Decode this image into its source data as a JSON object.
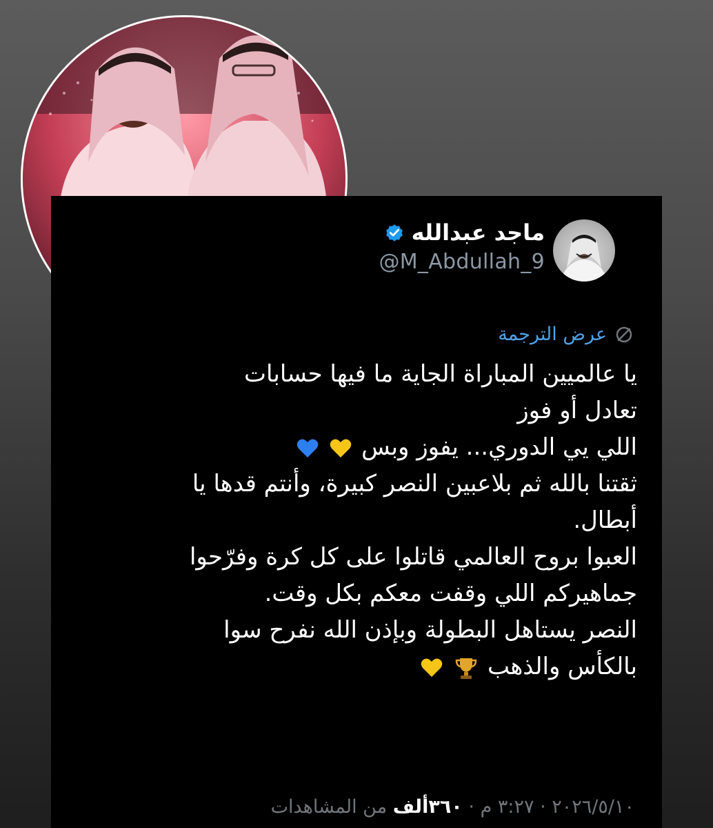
{
  "tweet": {
    "display_name": "ماجد عبدالله",
    "handle": "@M_Abdullah_9",
    "translate_label": "عرض الترجمة",
    "lines": [
      "يا عالميين المباراة الجاية ما فيها حسابات",
      "تعادل أو فوز",
      "اللي يي الدوري... يفوز وبس",
      "ثقتنا بالله ثم بلاعبين النصر كبيرة، وأنتم قدها يا",
      "أبطال.",
      "العبوا بروح العالمي قاتلوا على كل كرة وفرّحوا",
      "جماهيركم اللي وقفت معكم بكل وقت.",
      "النصر يستاهل البطولة وبإذن الله نفرح سوا",
      "بالكأس والذهب"
    ],
    "footer": {
      "time": "٣:٢٧ م",
      "separator": "·",
      "date": "٢٠٢٦/٥/١٠",
      "views_count": "٣٦٠ألف",
      "views_label": "من المشاهدات"
    }
  },
  "icons": {
    "verified": "verified-badge-icon",
    "translate": "translate-icon",
    "yellow_heart": "yellow-heart-icon",
    "blue_heart": "blue-heart-icon",
    "trophy": "trophy-icon"
  },
  "colors": {
    "card_background": "#000000",
    "link_blue": "#4ea1e8",
    "verified_blue": "#1d9bf0",
    "muted_text": "#71767b",
    "handle_text": "#8b98a5"
  }
}
